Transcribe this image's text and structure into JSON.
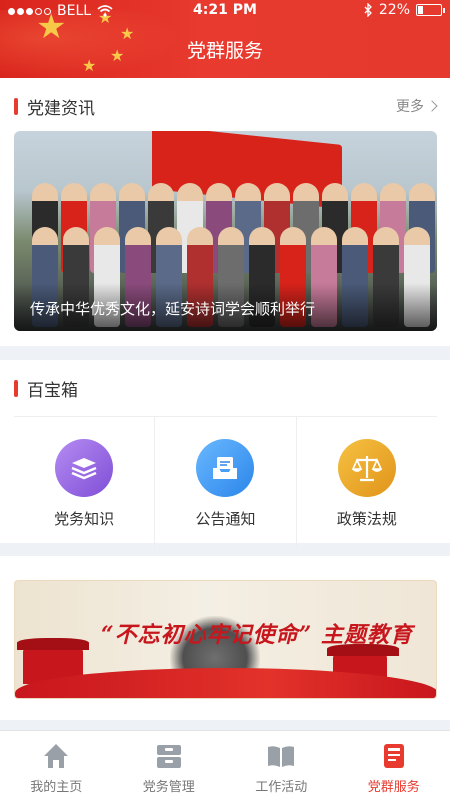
{
  "status_bar": {
    "carrier": "BELL",
    "time": "4:21 PM",
    "battery": "22%",
    "battery_level": 0.22
  },
  "header": {
    "title": "党群服务"
  },
  "news": {
    "section_title": "党建资讯",
    "more_label": "更多",
    "featured_caption": "传承中华优秀文化，延安诗词学会顺利举行"
  },
  "toolbox": {
    "section_title": "百宝箱",
    "items": [
      {
        "label": "党务知识",
        "icon": "books-icon",
        "color": "#9a6be0"
      },
      {
        "label": "公告通知",
        "icon": "mail-tray-icon",
        "color": "#3a9af0"
      },
      {
        "label": "政策法规",
        "icon": "scales-icon",
        "color": "#e9a41a"
      }
    ]
  },
  "promo_banner": {
    "text": "“不忘初心牢记使命” 主题教育"
  },
  "tabbar": {
    "tabs": [
      {
        "label": "我的主页",
        "icon": "home-icon",
        "active": false
      },
      {
        "label": "党务管理",
        "icon": "cabinet-icon",
        "active": false
      },
      {
        "label": "工作活动",
        "icon": "open-book-icon",
        "active": false
      },
      {
        "label": "党群服务",
        "icon": "service-card-icon",
        "active": true
      }
    ]
  },
  "colors": {
    "accent": "#e83a2f",
    "inactive_tab": "#777777",
    "background": "#eef1f5"
  }
}
